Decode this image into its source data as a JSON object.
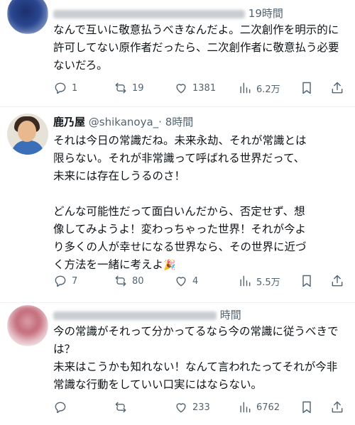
{
  "posts": [
    {
      "time": "19時間",
      "text": "なんで互いに敬意払うべきなんだよ。二次創作を明示的に許可してない原作者だったら、二次創作者に敬意払う必要ないだろ。",
      "reply_count": "1",
      "repost_count": "19",
      "like_count": "1381",
      "view_count": "6.2万"
    },
    {
      "name": "鹿乃屋",
      "handle": "@shikanoya_",
      "time": "· 8時間",
      "text_line1": "それは今日の常識だね。未来永劫、それが常識とは",
      "text_line2": "限らない。それが非常識って呼ばれる世界だって、",
      "text_line3": "未来には存在しうるのさ！",
      "text_line4": "",
      "text_line5": "どんな可能性だって面白いんだから、否定せず、想",
      "text_line6": "像してみようよ！変わっちゃった世界！それが今よ",
      "text_line7": "り多くの人が幸せになる世界なら、その世界に近づ",
      "text_line8": "く方法を一緒に考えよ",
      "emoji": "🎉",
      "reply_count": "7",
      "repost_count": "80",
      "like_count": "4",
      "view_count": "5.5万"
    },
    {
      "time": "時間",
      "text": "今の常識がそれって分かってるなら今の常識に従うべきでは？\n未来はこうかも知れない！なんて言われたってそれが今非常識な行動をしていい口実にはならない。",
      "reply_count": "",
      "repost_count": "",
      "like_count": "233",
      "view_count": "6762"
    }
  ],
  "icons": {
    "reply": "reply-icon",
    "repost": "repost-icon",
    "like": "like-icon",
    "views": "views-icon",
    "bookmark": "bookmark-icon",
    "share": "share-icon"
  },
  "colors": {
    "text": "#0f1419",
    "muted": "#536471",
    "divider": "#eff3f4"
  }
}
